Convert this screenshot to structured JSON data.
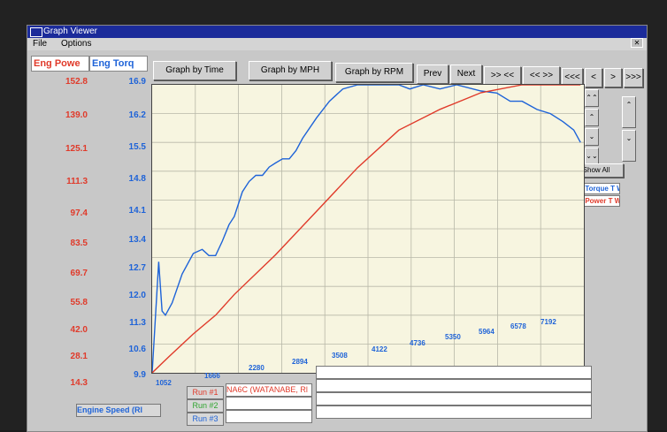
{
  "window": {
    "title": "Graph Viewer"
  },
  "menu": {
    "file": "File",
    "options": "Options"
  },
  "headers": {
    "power": "Eng Powe",
    "torque": "Eng Torq"
  },
  "power_ticks": [
    "152.8",
    "139.0",
    "125.1",
    "111.3",
    "97.4",
    "83.5",
    "69.7",
    "55.8",
    "42.0",
    "28.1",
    "14.3"
  ],
  "torque_ticks": [
    "16.9",
    "16.2",
    "15.5",
    "14.8",
    "14.1",
    "13.4",
    "12.7",
    "12.0",
    "11.3",
    "10.6",
    "9.9"
  ],
  "buttons": {
    "by_time": "Graph by Time",
    "by_mph": "Graph by MPH",
    "by_rpm": "Graph by RPM",
    "prev": "Prev",
    "next": "Next",
    "zoom_in": ">> <<",
    "zoom_out": "<< >>"
  },
  "scroll_buttons": [
    "<<<",
    "<",
    ">",
    ">>>"
  ],
  "side_controls": {
    "show_all": "Show All"
  },
  "legend": {
    "torque": "Eng Torque T WC",
    "power": "Eng Power T WC"
  },
  "x_ticks": [
    "1052",
    "1666",
    "2280",
    "2894",
    "3508",
    "4122",
    "4736",
    "5350",
    "5964",
    "6578",
    "7192"
  ],
  "bottom": {
    "axis": "Engine Speed (Rl",
    "run1": "Run #1",
    "run2": "Run #2",
    "run3": "Run #3",
    "vehicle": "NA6C (WATANABE, Rl"
  },
  "colors": {
    "power": "#e03a2a",
    "torque": "#1e63d8",
    "plot_bg": "#f7f5e0"
  },
  "chart_data": {
    "type": "line",
    "xlabel": "Engine Speed (Rl",
    "xlim": [
      1052,
      7500
    ],
    "ylim_left": [
      14.3,
      152.8
    ],
    "ylim_right": [
      9.9,
      16.9
    ],
    "series": [
      {
        "name": "Eng Torque T WC",
        "axis": "right",
        "color": "#1e63d8",
        "x": [
          1052,
          1150,
          1200,
          1250,
          1350,
          1500,
          1666,
          1800,
          1900,
          2000,
          2100,
          2200,
          2280,
          2400,
          2500,
          2600,
          2700,
          2800,
          2894,
          3000,
          3100,
          3200,
          3300,
          3508,
          3700,
          3900,
          4122,
          4300,
          4500,
          4736,
          4900,
          5100,
          5350,
          5600,
          5964,
          6200,
          6400,
          6578,
          6800,
          7000,
          7192,
          7350,
          7450
        ],
        "y": [
          9.9,
          12.6,
          11.4,
          11.3,
          11.6,
          12.3,
          12.8,
          12.9,
          12.75,
          12.75,
          13.1,
          13.5,
          13.7,
          14.3,
          14.55,
          14.7,
          14.7,
          14.9,
          15.0,
          15.1,
          15.1,
          15.3,
          15.6,
          16.1,
          16.5,
          16.8,
          17.0,
          16.95,
          16.9,
          16.9,
          16.8,
          16.9,
          16.8,
          16.9,
          16.75,
          16.7,
          16.5,
          16.5,
          16.3,
          16.2,
          16.0,
          15.8,
          15.5
        ]
      },
      {
        "name": "Eng Power T WC",
        "axis": "left",
        "color": "#e03a2a",
        "x": [
          1052,
          1300,
          1666,
          2000,
          2280,
          2894,
          3508,
          4122,
          4736,
          5350,
          5964,
          6578,
          7192,
          7450
        ],
        "y": [
          14.3,
          22,
          33,
          42,
          52,
          71,
          92,
          113,
          131,
          141,
          149,
          154,
          159,
          160
        ]
      }
    ]
  }
}
